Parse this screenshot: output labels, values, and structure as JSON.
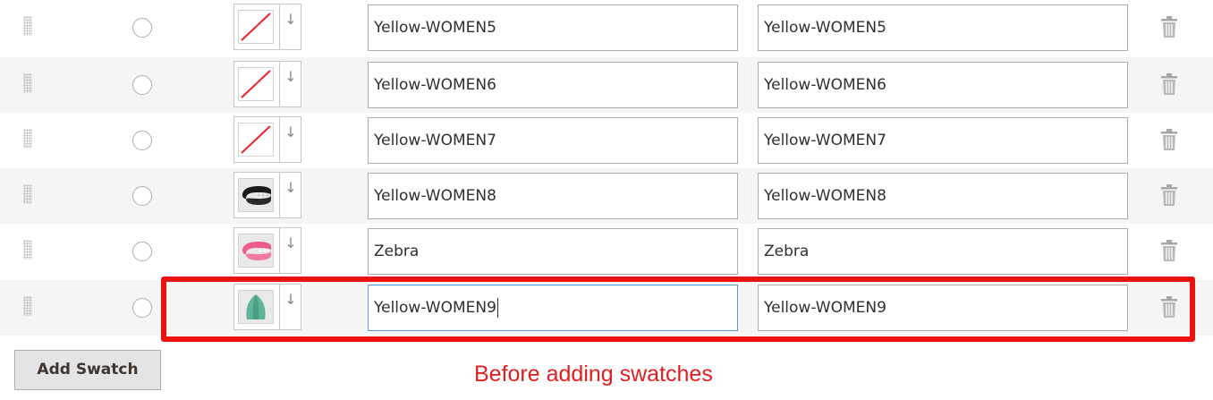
{
  "rows": [
    {
      "swatch": "no-image-swatch-icon",
      "admin_value": "Yellow-WOMEN5",
      "default_value": "Yellow-WOMEN5"
    },
    {
      "swatch": "no-image-swatch-icon",
      "admin_value": "Yellow-WOMEN6",
      "default_value": "Yellow-WOMEN6"
    },
    {
      "swatch": "no-image-swatch-icon",
      "admin_value": "Yellow-WOMEN7",
      "default_value": "Yellow-WOMEN7"
    },
    {
      "swatch": "black-collar-swatch-image",
      "admin_value": "Yellow-WOMEN8",
      "default_value": "Yellow-WOMEN8"
    },
    {
      "swatch": "pink-collar-swatch-image",
      "admin_value": "Zebra",
      "default_value": "Zebra"
    },
    {
      "swatch": "teal-leaf-swatch-image",
      "admin_value": "Yellow-WOMEN9",
      "default_value": "Yellow-WOMEN9"
    }
  ],
  "icons": {
    "drag": "drag-handle-icon",
    "upload": "arrow-down-icon",
    "delete": "trash-icon"
  },
  "colors": {
    "highlight": "#ee1111",
    "caption": "#e02020",
    "focus_border": "#5a9ad6"
  },
  "add_swatch_label": "Add Swatch",
  "annotation": "Before adding swatches"
}
